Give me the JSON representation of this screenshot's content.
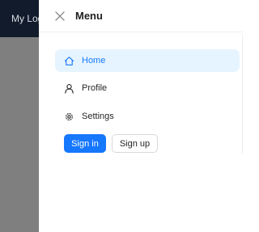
{
  "backdrop": {
    "logo_text": "My Logo"
  },
  "drawer": {
    "title": "Menu",
    "close_icon": "close-icon",
    "menu_items": [
      {
        "label": "Home",
        "icon": "home-icon",
        "active": true
      },
      {
        "label": "Profile",
        "icon": "user-icon",
        "active": false
      },
      {
        "label": "Settings",
        "icon": "gear-icon",
        "active": false
      }
    ],
    "buttons": {
      "sign_in": "Sign in",
      "sign_up": "Sign up"
    }
  },
  "colors": {
    "accent": "#1677ff",
    "active_bg": "#e6f4ff",
    "header_bg": "#111b2b",
    "backdrop": "#7f7f7f"
  }
}
